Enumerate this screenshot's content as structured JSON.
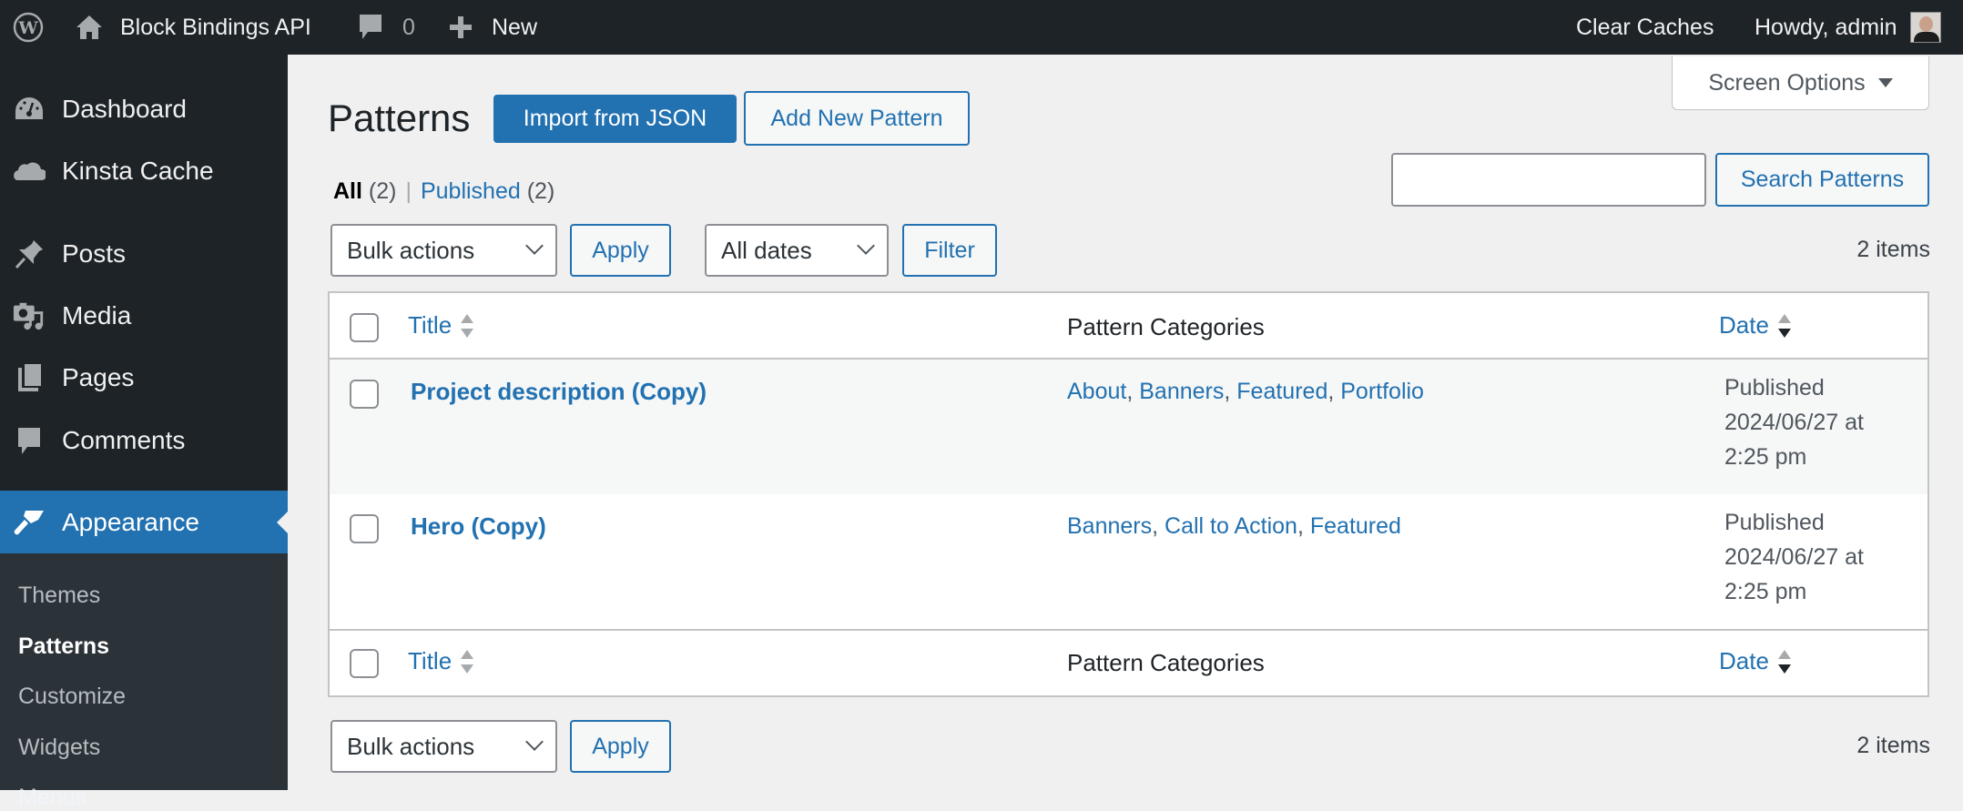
{
  "adminbar": {
    "site_name": "Block Bindings API",
    "comments_count": "0",
    "new_label": "New",
    "clear_caches": "Clear Caches",
    "howdy": "Howdy, admin"
  },
  "sidebar": {
    "items": [
      {
        "label": "Dashboard",
        "icon": "dashboard-icon"
      },
      {
        "label": "Kinsta Cache",
        "icon": "cloud-icon"
      },
      {
        "label": "Posts",
        "icon": "pin-icon"
      },
      {
        "label": "Media",
        "icon": "media-icon"
      },
      {
        "label": "Pages",
        "icon": "pages-icon"
      },
      {
        "label": "Comments",
        "icon": "comment-icon"
      },
      {
        "label": "Appearance",
        "icon": "paintbrush-icon",
        "current": true
      }
    ],
    "submenu": [
      {
        "label": "Themes"
      },
      {
        "label": "Patterns",
        "current": true
      },
      {
        "label": "Customize"
      },
      {
        "label": "Widgets"
      },
      {
        "label": "Menus"
      }
    ]
  },
  "header": {
    "title": "Patterns",
    "import_button": "Import from JSON",
    "add_new_button": "Add New Pattern",
    "screen_options": "Screen Options"
  },
  "views": {
    "all_label": "All",
    "all_count": "(2)",
    "separator": "|",
    "published_label": "Published",
    "published_count": "(2)"
  },
  "search": {
    "value": "",
    "button": "Search Patterns"
  },
  "tablenav_top": {
    "bulk_actions": "Bulk actions",
    "apply": "Apply",
    "dates": "All dates",
    "filter": "Filter",
    "count": "2 items"
  },
  "tablenav_bottom": {
    "bulk_actions": "Bulk actions",
    "apply": "Apply",
    "count": "2 items"
  },
  "table": {
    "columns": {
      "title": "Title",
      "categories": "Pattern Categories",
      "date": "Date"
    },
    "rows": [
      {
        "title": "Project description (Copy)",
        "categories": [
          "About",
          "Banners",
          "Featured",
          "Portfolio"
        ],
        "status": "Published",
        "date": "2024/06/27 at",
        "time": "2:25 pm"
      },
      {
        "title": "Hero (Copy)",
        "categories": [
          "Banners",
          "Call to Action",
          "Featured"
        ],
        "status": "Published",
        "date": "2024/06/27 at",
        "time": "2:25 pm"
      }
    ]
  },
  "colors": {
    "accent": "#2271b1",
    "adminbar_bg": "#1d2327",
    "submenu_bg": "#2c3338",
    "page_bg": "#f0f0f1"
  }
}
